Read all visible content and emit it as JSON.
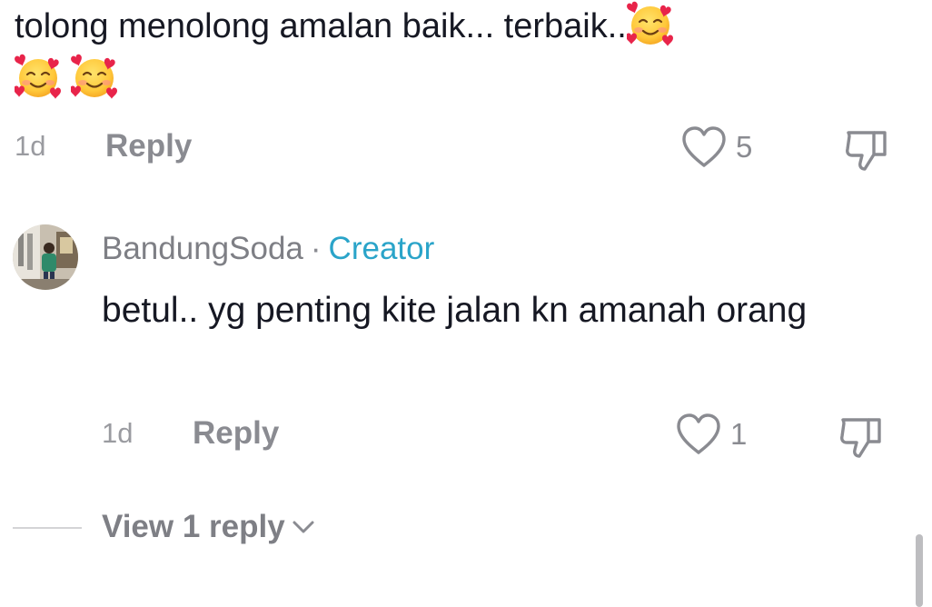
{
  "parent_comment": {
    "text": "tolong menolong amalan baik... terbaik..",
    "emoji_name": "smiling-face-with-hearts-emoji",
    "trailing_emoji_count": 2,
    "time": "1d",
    "reply_label": "Reply",
    "like_count": "5"
  },
  "reply_comment": {
    "username": "BandungSoda",
    "separator": "·",
    "badge": "Creator",
    "text": "betul.. yg penting kite jalan kn amanah orang",
    "time": "1d",
    "reply_label": "Reply",
    "like_count": "1"
  },
  "view_replies": {
    "label": "View 1 reply"
  },
  "colors": {
    "creator_accent": "#2aa4c9",
    "muted_text": "#8a8b91",
    "primary_text": "#161823"
  }
}
